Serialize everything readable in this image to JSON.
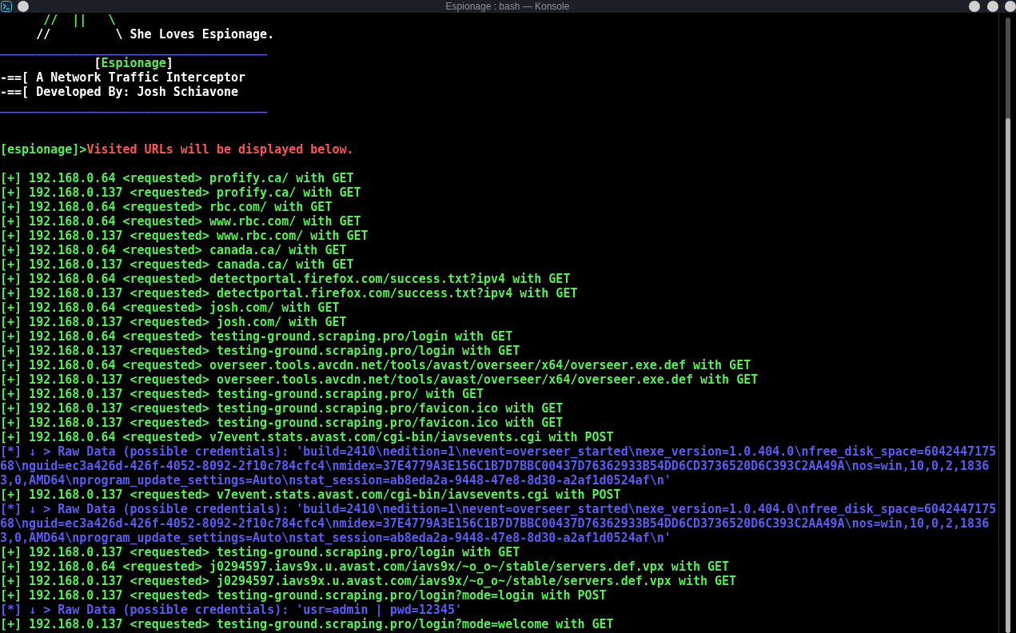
{
  "window": {
    "title": "Espionage : bash — Konsole"
  },
  "banner": {
    "art": [
      {
        "kind": "art",
        "text": "//  ||   \\"
      },
      {
        "kind": "caption",
        "text": "//         \\ She Loves Espionage."
      }
    ],
    "rule_top": "_____________________________________",
    "heading": {
      "open": "[",
      "name": "Espionage",
      "close": "]"
    },
    "taglines": [
      "-==[ A Network Traffic Interceptor",
      "-==[ Developed By: Josh Schiavone"
    ],
    "rule_bottom": "_____________________________________"
  },
  "prompt": {
    "tag": "[espionage]>",
    "message": "Visited URLs will be displayed below."
  },
  "log": [
    {
      "kind": "request",
      "text": "[+] 192.168.0.64 <requested> profify.ca/ with GET"
    },
    {
      "kind": "request",
      "text": "[+] 192.168.0.137 <requested> profify.ca/ with GET"
    },
    {
      "kind": "request",
      "text": "[+] 192.168.0.64 <requested> rbc.com/ with GET"
    },
    {
      "kind": "request",
      "text": "[+] 192.168.0.64 <requested> www.rbc.com/ with GET"
    },
    {
      "kind": "request",
      "text": "[+] 192.168.0.137 <requested> www.rbc.com/ with GET"
    },
    {
      "kind": "request",
      "text": "[+] 192.168.0.64 <requested> canada.ca/ with GET"
    },
    {
      "kind": "request",
      "text": "[+] 192.168.0.137 <requested> canada.ca/ with GET"
    },
    {
      "kind": "request",
      "text": "[+] 192.168.0.64 <requested> detectportal.firefox.com/success.txt?ipv4 with GET"
    },
    {
      "kind": "request",
      "text": "[+] 192.168.0.137 <requested> detectportal.firefox.com/success.txt?ipv4 with GET"
    },
    {
      "kind": "request",
      "text": "[+] 192.168.0.64 <requested> josh.com/ with GET"
    },
    {
      "kind": "request",
      "text": "[+] 192.168.0.137 <requested> josh.com/ with GET"
    },
    {
      "kind": "request",
      "text": "[+] 192.168.0.64 <requested> testing-ground.scraping.pro/login with GET"
    },
    {
      "kind": "request",
      "text": "[+] 192.168.0.137 <requested> testing-ground.scraping.pro/login with GET"
    },
    {
      "kind": "request",
      "text": "[+] 192.168.0.64 <requested> overseer.tools.avcdn.net/tools/avast/overseer/x64/overseer.exe.def with GET"
    },
    {
      "kind": "request",
      "text": "[+] 192.168.0.137 <requested> overseer.tools.avcdn.net/tools/avast/overseer/x64/overseer.exe.def with GET"
    },
    {
      "kind": "request",
      "text": "[+] 192.168.0.137 <requested> testing-ground.scraping.pro/ with GET"
    },
    {
      "kind": "request",
      "text": "[+] 192.168.0.137 <requested> testing-ground.scraping.pro/favicon.ico with GET"
    },
    {
      "kind": "request",
      "text": "[+] 192.168.0.137 <requested> testing-ground.scraping.pro/favicon.ico with GET"
    },
    {
      "kind": "request",
      "text": "[+] 192.168.0.64 <requested> v7event.stats.avast.com/cgi-bin/iavsevents.cgi with POST"
    },
    {
      "kind": "raw",
      "text": "[*] ↓ > Raw Data (possible credentials): 'build=2410\\nedition=1\\nevent=overseer_started\\nexe_version=1.0.404.0\\nfree_disk_space=604244717568\\nguid=ec3a426d-426f-4052-8092-2f10c784cfc4\\nmidex=37E4779A3E156C1B7D7BBC00437D76362933B54DD6CD3736520D6C393C2AA49A\\nos=win,10,0,2,18363,0,AMD64\\nprogram_update_settings=Auto\\nstat_session=ab8eda2a-9448-47e8-8d30-a2af1d0524af\\n'"
    },
    {
      "kind": "request",
      "text": "[+] 192.168.0.137 <requested> v7event.stats.avast.com/cgi-bin/iavsevents.cgi with POST"
    },
    {
      "kind": "raw",
      "text": "[*] ↓ > Raw Data (possible credentials): 'build=2410\\nedition=1\\nevent=overseer_started\\nexe_version=1.0.404.0\\nfree_disk_space=604244717568\\nguid=ec3a426d-426f-4052-8092-2f10c784cfc4\\nmidex=37E4779A3E156C1B7D7BBC00437D76362933B54DD6CD3736520D6C393C2AA49A\\nos=win,10,0,2,18363,0,AMD64\\nprogram_update_settings=Auto\\nstat_session=ab8eda2a-9448-47e8-8d30-a2af1d0524af\\n'"
    },
    {
      "kind": "request",
      "text": "[+] 192.168.0.137 <requested> testing-ground.scraping.pro/login with GET"
    },
    {
      "kind": "request",
      "text": "[+] 192.168.0.64 <requested> j0294597.iavs9x.u.avast.com/iavs9x/~o_o~/stable/servers.def.vpx with GET"
    },
    {
      "kind": "request",
      "text": "[+] 192.168.0.137 <requested> j0294597.iavs9x.u.avast.com/iavs9x/~o_o~/stable/servers.def.vpx with GET"
    },
    {
      "kind": "request",
      "text": "[+] 192.168.0.137 <requested> testing-ground.scraping.pro/login?mode=login with POST"
    },
    {
      "kind": "raw",
      "text": "[*] ↓ > Raw Data (possible credentials): 'usr=admin | pwd=12345'"
    },
    {
      "kind": "request",
      "text": "[+] 192.168.0.137 <requested> testing-ground.scraping.pro/login?mode=welcome with GET"
    }
  ]
}
